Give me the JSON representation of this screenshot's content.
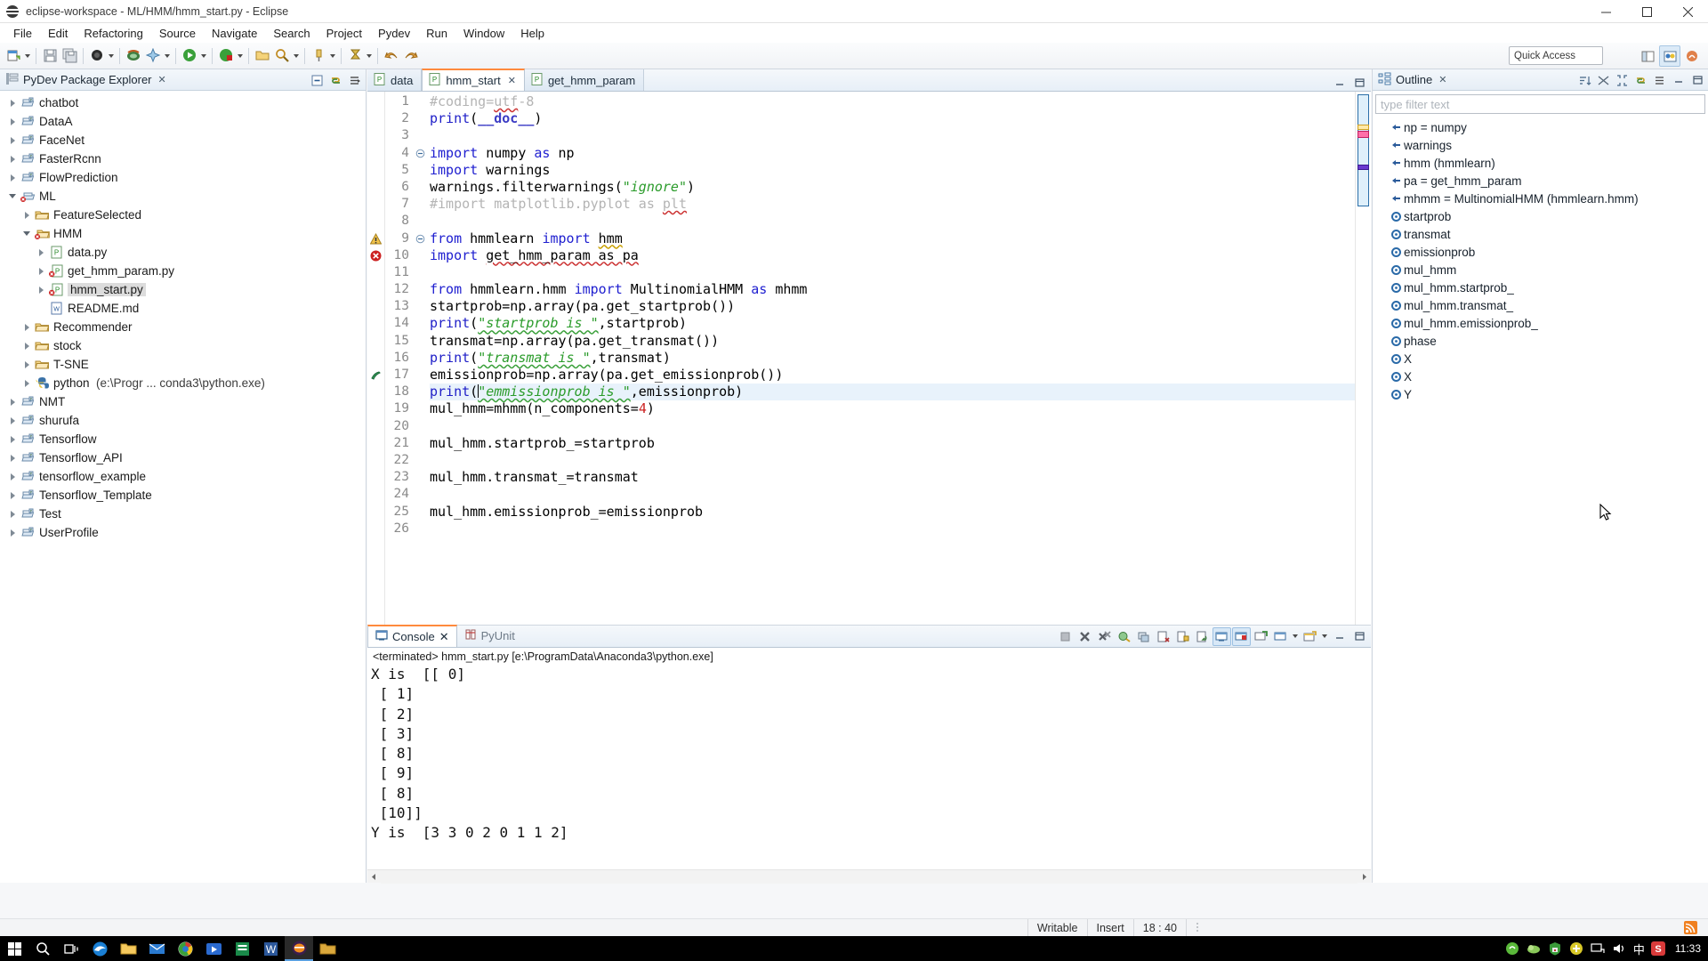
{
  "window": {
    "title": "eclipse-workspace - ML/HMM/hmm_start.py - Eclipse",
    "minimize_label": "Minimize",
    "maximize_label": "Maximize",
    "close_label": "Close"
  },
  "menubar": {
    "items": [
      "File",
      "Edit",
      "Refactoring",
      "Source",
      "Navigate",
      "Search",
      "Project",
      "Pydev",
      "Run",
      "Window",
      "Help"
    ]
  },
  "toolbar": {
    "quick_access_placeholder": "Quick Access"
  },
  "explorer": {
    "title": "PyDev Package Explorer",
    "close_label": "✕",
    "items": [
      {
        "label": "chatbot",
        "depth": 0,
        "arrow": "collapsed",
        "icon": "project-icon",
        "selected": false
      },
      {
        "label": "DataA",
        "depth": 0,
        "arrow": "collapsed",
        "icon": "project-icon",
        "selected": false
      },
      {
        "label": "FaceNet",
        "depth": 0,
        "arrow": "collapsed",
        "icon": "project-icon",
        "selected": false
      },
      {
        "label": "FasterRcnn",
        "depth": 0,
        "arrow": "collapsed",
        "icon": "project-icon",
        "selected": false
      },
      {
        "label": "FlowPrediction",
        "depth": 0,
        "arrow": "collapsed",
        "icon": "project-icon",
        "selected": false
      },
      {
        "label": "ML",
        "depth": 0,
        "arrow": "expanded",
        "icon": "project-error-icon",
        "selected": false
      },
      {
        "label": "FeatureSelected",
        "depth": 1,
        "arrow": "collapsed",
        "icon": "folder-icon",
        "selected": false
      },
      {
        "label": "HMM",
        "depth": 1,
        "arrow": "expanded",
        "icon": "folder-error-icon",
        "selected": false
      },
      {
        "label": "data.py",
        "depth": 2,
        "arrow": "collapsed",
        "icon": "py-file-icon",
        "selected": false
      },
      {
        "label": "get_hmm_param.py",
        "depth": 2,
        "arrow": "collapsed",
        "icon": "py-file-error-icon",
        "selected": false
      },
      {
        "label": "hmm_start.py",
        "depth": 2,
        "arrow": "collapsed",
        "icon": "py-file-error-icon",
        "selected": true
      },
      {
        "label": "README.md",
        "depth": 2,
        "arrow": "none",
        "icon": "md-file-icon",
        "selected": false
      },
      {
        "label": "Recommender",
        "depth": 1,
        "arrow": "collapsed",
        "icon": "folder-icon",
        "selected": false
      },
      {
        "label": "stock",
        "depth": 1,
        "arrow": "collapsed",
        "icon": "folder-icon",
        "selected": false
      },
      {
        "label": "T-SNE",
        "depth": 1,
        "arrow": "collapsed",
        "icon": "folder-icon",
        "selected": false
      },
      {
        "label": "python",
        "sublabel": "(e:\\Progr ... conda3\\python.exe)",
        "depth": 1,
        "arrow": "collapsed",
        "icon": "python-icon",
        "selected": false
      },
      {
        "label": "NMT",
        "depth": 0,
        "arrow": "collapsed",
        "icon": "project-icon",
        "selected": false
      },
      {
        "label": "shurufa",
        "depth": 0,
        "arrow": "collapsed",
        "icon": "project-icon",
        "selected": false
      },
      {
        "label": "Tensorflow",
        "depth": 0,
        "arrow": "collapsed",
        "icon": "project-icon",
        "selected": false
      },
      {
        "label": "Tensorflow_API",
        "depth": 0,
        "arrow": "collapsed",
        "icon": "project-icon",
        "selected": false
      },
      {
        "label": "tensorflow_example",
        "depth": 0,
        "arrow": "collapsed",
        "icon": "project-icon",
        "selected": false
      },
      {
        "label": "Tensorflow_Template",
        "depth": 0,
        "arrow": "collapsed",
        "icon": "project-icon",
        "selected": false
      },
      {
        "label": "Test",
        "depth": 0,
        "arrow": "collapsed",
        "icon": "project-icon",
        "selected": false
      },
      {
        "label": "UserProfile",
        "depth": 0,
        "arrow": "collapsed",
        "icon": "project-icon",
        "selected": false
      }
    ]
  },
  "editor": {
    "tabs": [
      {
        "label": "data",
        "active": false,
        "closeable": false
      },
      {
        "label": "hmm_start",
        "active": true,
        "closeable": true
      },
      {
        "label": "get_hmm_param",
        "active": false,
        "closeable": false
      }
    ],
    "lines": [
      {
        "no": 1,
        "marker": "",
        "fold": "",
        "html": "<span class=\"c\">#coding=<span class=\"sq\">utf</span>-8</span>"
      },
      {
        "no": 2,
        "marker": "",
        "fold": "",
        "html": "<span class=\"fn\">print</span><span class=\"pl\">(</span><span class=\"kb\">__doc__</span><span class=\"pl\">)</span>"
      },
      {
        "no": 3,
        "marker": "",
        "fold": "",
        "html": ""
      },
      {
        "no": 4,
        "marker": "",
        "fold": "start",
        "html": "<span class=\"kw2\">import</span> <span class=\"pl\">numpy</span> <span class=\"kw2\">as</span> <span class=\"pl\">np</span>"
      },
      {
        "no": 5,
        "marker": "",
        "fold": "",
        "html": "<span class=\"kw2\">import</span> <span class=\"pl\">warnings</span>"
      },
      {
        "no": 6,
        "marker": "",
        "fold": "",
        "html": "<span class=\"pl\">warnings.filterwarnings(</span><span class=\"si\">\"ignore\"</span><span class=\"pl\">)</span>"
      },
      {
        "no": 7,
        "marker": "",
        "fold": "",
        "html": "<span class=\"c\">#import matplotlib.pyplot as <span class=\"sq\">plt</span></span>"
      },
      {
        "no": 8,
        "marker": "",
        "fold": "",
        "html": ""
      },
      {
        "no": 9,
        "marker": "warning",
        "fold": "start",
        "html": "<span class=\"kw2\">from</span> <span class=\"pl\">hmmlearn</span> <span class=\"kw2\">import</span> <span class=\"pl sqy\">hmm</span>"
      },
      {
        "no": 10,
        "marker": "error",
        "fold": "",
        "html": "<span class=\"kw2\">import</span> <span class=\"pl sq\">get_hmm_param as pa</span>"
      },
      {
        "no": 11,
        "marker": "",
        "fold": "",
        "html": ""
      },
      {
        "no": 12,
        "marker": "",
        "fold": "",
        "html": "<span class=\"kw2\">from</span> <span class=\"pl\">hmmlearn.hmm</span> <span class=\"kw2\">import</span> <span class=\"pl\">MultinomialHMM</span> <span class=\"kw2\">as</span> <span class=\"pl\">mhmm</span>"
      },
      {
        "no": 13,
        "marker": "",
        "fold": "",
        "html": "<span class=\"pl\">startprob=np.array(pa.get_startprob())</span>"
      },
      {
        "no": 14,
        "marker": "",
        "fold": "",
        "html": "<span class=\"fn\">print</span><span class=\"pl\">(</span><span class=\"si sqg\">\"startprob is \"</span><span class=\"pl\">,startprob)</span>"
      },
      {
        "no": 15,
        "marker": "",
        "fold": "",
        "html": "<span class=\"pl\">transmat=np.array(pa.get_transmat())</span>"
      },
      {
        "no": 16,
        "marker": "",
        "fold": "",
        "html": "<span class=\"fn\">print</span><span class=\"pl\">(</span><span class=\"si sqg\">\"transmat is \"</span><span class=\"pl\">,transmat)</span>"
      },
      {
        "no": 17,
        "marker": "bookmark",
        "fold": "",
        "html": "<span class=\"pl\">emissionprob=np.array(pa.get_emissionprob())</span>"
      },
      {
        "no": 18,
        "marker": "",
        "fold": "",
        "highlight": true,
        "html": "<span class=\"fn\">print</span><span class=\"pl\">(</span><span class=\"caret\"></span><span class=\"si sqg\">\"emmissionprob is \"</span><span class=\"pl\">,emissionprob)</span>"
      },
      {
        "no": 19,
        "marker": "",
        "fold": "",
        "html": "<span class=\"pl\">mul_hmm=mhmm(n_components=</span><span class=\"n\">4</span><span class=\"pl\">)</span>"
      },
      {
        "no": 20,
        "marker": "",
        "fold": "",
        "html": ""
      },
      {
        "no": 21,
        "marker": "",
        "fold": "",
        "html": "<span class=\"pl\">mul_hmm.startprob_=startprob</span>"
      },
      {
        "no": 22,
        "marker": "",
        "fold": "",
        "html": ""
      },
      {
        "no": 23,
        "marker": "",
        "fold": "",
        "html": "<span class=\"pl\">mul_hmm.transmat_=transmat</span>"
      },
      {
        "no": 24,
        "marker": "",
        "fold": "",
        "html": ""
      },
      {
        "no": 25,
        "marker": "",
        "fold": "",
        "html": "<span class=\"pl\">mul_hmm.emissionprob_=emissionprob</span>"
      },
      {
        "no": 26,
        "marker": "",
        "fold": "",
        "html": ""
      }
    ]
  },
  "outline": {
    "title": "Outline",
    "close_label": "✕",
    "filter_placeholder": "type filter text",
    "items": [
      {
        "label": "np = numpy",
        "icon": "import-icon"
      },
      {
        "label": "warnings",
        "icon": "import-icon"
      },
      {
        "label": "hmm (hmmlearn)",
        "icon": "import-icon"
      },
      {
        "label": "pa = get_hmm_param",
        "icon": "import-icon"
      },
      {
        "label": "mhmm = MultinomialHMM (hmmlearn.hmm)",
        "icon": "import-icon"
      },
      {
        "label": "startprob",
        "icon": "attribute-icon"
      },
      {
        "label": "transmat",
        "icon": "attribute-icon"
      },
      {
        "label": "emissionprob",
        "icon": "attribute-icon"
      },
      {
        "label": "mul_hmm",
        "icon": "attribute-icon"
      },
      {
        "label": "mul_hmm.startprob_",
        "icon": "attribute-icon"
      },
      {
        "label": "mul_hmm.transmat_",
        "icon": "attribute-icon"
      },
      {
        "label": "mul_hmm.emissionprob_",
        "icon": "attribute-icon"
      },
      {
        "label": "phase",
        "icon": "attribute-icon"
      },
      {
        "label": "X",
        "icon": "attribute-icon"
      },
      {
        "label": "X",
        "icon": "attribute-icon"
      },
      {
        "label": "Y",
        "icon": "attribute-icon"
      }
    ]
  },
  "console": {
    "tabs": [
      {
        "label": "Console",
        "active": true,
        "closeable": true
      },
      {
        "label": "PyUnit",
        "active": false,
        "closeable": false
      }
    ],
    "process_line": "<terminated> hmm_start.py [e:\\ProgramData\\Anaconda3\\python.exe]",
    "output": "X is  [[ 0]\n [ 1]\n [ 2]\n [ 3]\n [ 8]\n [ 9]\n [ 8]\n [10]]\nY is  [3 3 0 2 0 1 1 2]"
  },
  "statusbar": {
    "writable": "Writable",
    "insert": "Insert",
    "position": "18 : 40"
  },
  "taskbar": {
    "ime_label": "中",
    "clock": "11:33",
    "items": [
      {
        "name": "start-button"
      },
      {
        "name": "search-icon"
      },
      {
        "name": "task-view-icon"
      },
      {
        "name": "browser-icon"
      },
      {
        "name": "file-explorer-icon"
      },
      {
        "name": "media-icon"
      },
      {
        "name": "chrome-icon"
      },
      {
        "name": "vs-icon"
      },
      {
        "name": "word-icon"
      },
      {
        "name": "app-orange-icon"
      },
      {
        "name": "eclipse-icon"
      },
      {
        "name": "terminal-icon"
      }
    ]
  },
  "colors": {
    "accent_orange": "#ff8a3d",
    "tree_selection": "#dcdcdc",
    "line_highlight": "#e8f2fb",
    "string_green": "#2a9b2a",
    "keyword_blue": "#2020d0",
    "error_red": "#cc2222",
    "comment_gray": "#b4b4b4"
  }
}
